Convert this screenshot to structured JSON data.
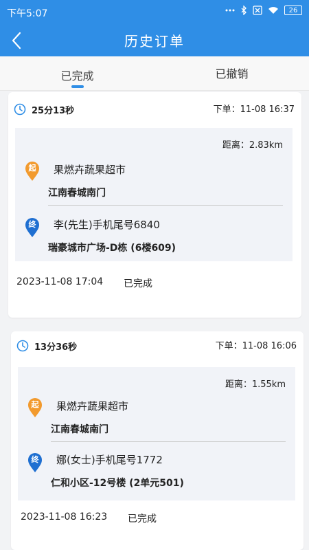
{
  "status_bar": {
    "time": "下午5:07",
    "battery": "26",
    "icons": [
      "dots-icon",
      "bluetooth-icon",
      "sim-off-icon",
      "wifi-icon",
      "battery-icon"
    ]
  },
  "header": {
    "title": "历史订单",
    "back_icon": "chevron-left-icon",
    "color": "#2f8ee6"
  },
  "tabs": [
    {
      "label": "已完成",
      "active": true
    },
    {
      "label": "已撤销",
      "active": false
    }
  ],
  "orders": [
    {
      "duration": "25分13秒",
      "order_time": "下单：11-08 16:37",
      "distance": "距离：2.83km",
      "from": {
        "badge": "起",
        "name": "果燃卉蔬果超市",
        "address": "江南春城南门"
      },
      "to": {
        "badge": "终",
        "name": "李(先生)手机尾号6840",
        "address": "瑞豪城市广场-D栋 (6楼609)"
      },
      "completed_time": "2023-11-08 17:04",
      "status": "已完成"
    },
    {
      "duration": "13分36秒",
      "order_time": "下单：11-08 16:06",
      "distance": "距离：1.55km",
      "from": {
        "badge": "起",
        "name": "果燃卉蔬果超市",
        "address": "江南春城南门"
      },
      "to": {
        "badge": "终",
        "name": "娜(女士)手机尾号1772",
        "address": "仁和小区-12号楼 (2单元501)"
      },
      "completed_time": "2023-11-08 16:23",
      "status": "已完成"
    }
  ],
  "colors": {
    "start_pin": "#f29a2e",
    "end_pin": "#1f6fd1",
    "accent": "#2f8ee6"
  }
}
